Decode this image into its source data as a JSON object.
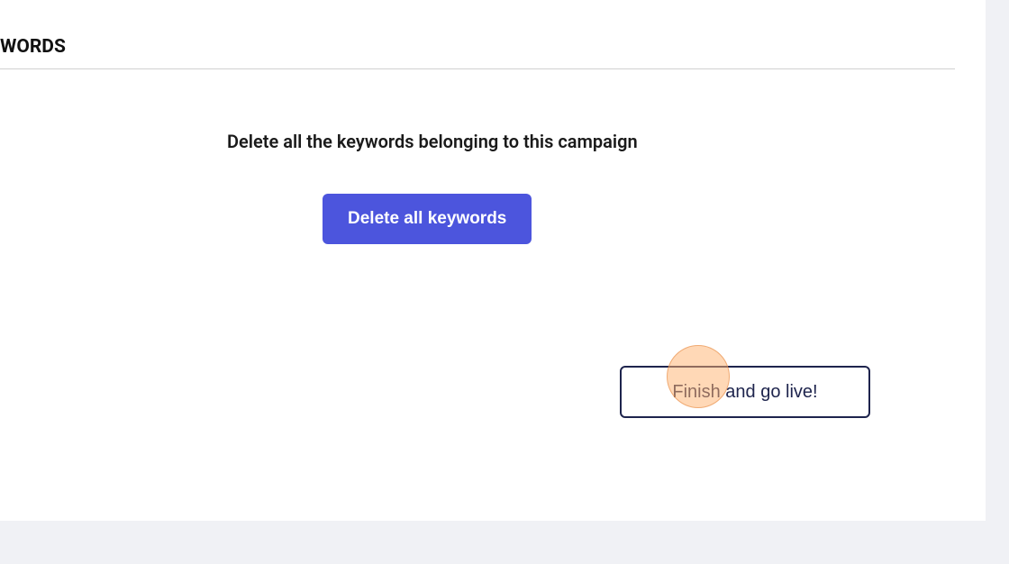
{
  "tab": {
    "label": "WORDS"
  },
  "content": {
    "deleteDescription": "Delete all the keywords belonging to this campaign",
    "deleteButtonLabel": "Delete all keywords",
    "finishButtonLabel": "Finish and go live!"
  }
}
